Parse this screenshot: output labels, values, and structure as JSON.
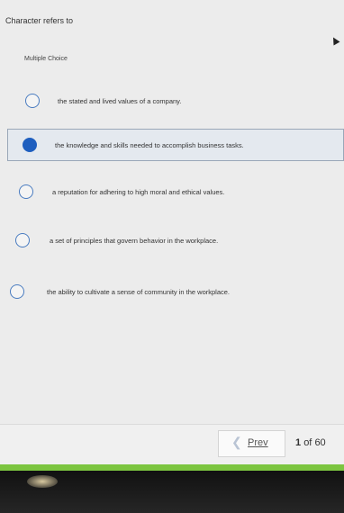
{
  "question": {
    "text": "Character refers to",
    "type_label": "Multiple Choice"
  },
  "choices": [
    {
      "text": "the stated and lived values of a company.",
      "selected": false
    },
    {
      "text": "the knowledge and skills needed to accomplish business tasks.",
      "selected": true
    },
    {
      "text": "a reputation for adhering to high moral and ethical values.",
      "selected": false
    },
    {
      "text": "a set of principles that govern behavior in the workplace.",
      "selected": false
    },
    {
      "text": "the ability to cultivate a sense of community in the workplace.",
      "selected": false
    }
  ],
  "navigation": {
    "prev_label": "Prev",
    "prev_icon": "chevron-left-icon",
    "current_page": "1",
    "of_label": "of",
    "total_pages": "60"
  },
  "colors": {
    "accent": "#1f5fbf",
    "progress_bar": "#7cc540"
  }
}
